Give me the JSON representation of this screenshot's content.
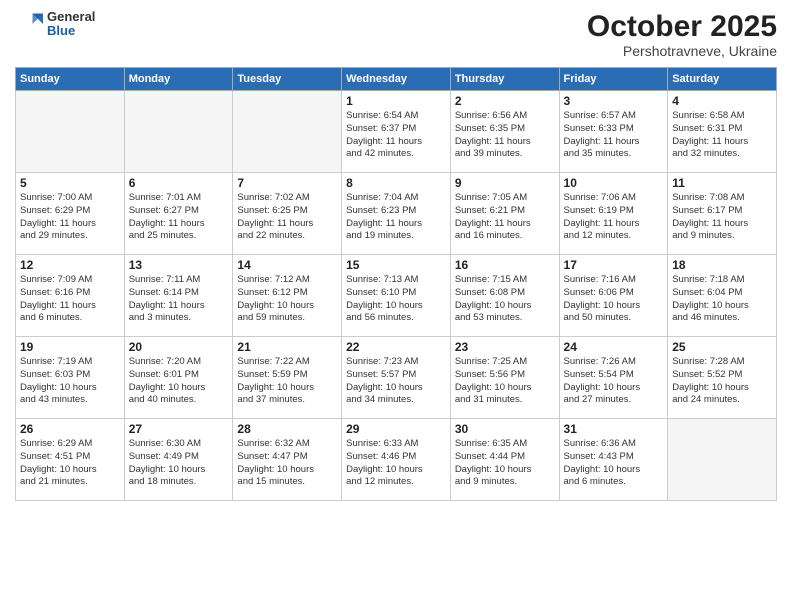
{
  "logo": {
    "general": "General",
    "blue": "Blue"
  },
  "title": {
    "month": "October 2025",
    "location": "Pershotravneve, Ukraine"
  },
  "weekdays": [
    "Sunday",
    "Monday",
    "Tuesday",
    "Wednesday",
    "Thursday",
    "Friday",
    "Saturday"
  ],
  "weeks": [
    [
      {
        "day": "",
        "info": ""
      },
      {
        "day": "",
        "info": ""
      },
      {
        "day": "",
        "info": ""
      },
      {
        "day": "1",
        "info": "Sunrise: 6:54 AM\nSunset: 6:37 PM\nDaylight: 11 hours\nand 42 minutes."
      },
      {
        "day": "2",
        "info": "Sunrise: 6:56 AM\nSunset: 6:35 PM\nDaylight: 11 hours\nand 39 minutes."
      },
      {
        "day": "3",
        "info": "Sunrise: 6:57 AM\nSunset: 6:33 PM\nDaylight: 11 hours\nand 35 minutes."
      },
      {
        "day": "4",
        "info": "Sunrise: 6:58 AM\nSunset: 6:31 PM\nDaylight: 11 hours\nand 32 minutes."
      }
    ],
    [
      {
        "day": "5",
        "info": "Sunrise: 7:00 AM\nSunset: 6:29 PM\nDaylight: 11 hours\nand 29 minutes."
      },
      {
        "day": "6",
        "info": "Sunrise: 7:01 AM\nSunset: 6:27 PM\nDaylight: 11 hours\nand 25 minutes."
      },
      {
        "day": "7",
        "info": "Sunrise: 7:02 AM\nSunset: 6:25 PM\nDaylight: 11 hours\nand 22 minutes."
      },
      {
        "day": "8",
        "info": "Sunrise: 7:04 AM\nSunset: 6:23 PM\nDaylight: 11 hours\nand 19 minutes."
      },
      {
        "day": "9",
        "info": "Sunrise: 7:05 AM\nSunset: 6:21 PM\nDaylight: 11 hours\nand 16 minutes."
      },
      {
        "day": "10",
        "info": "Sunrise: 7:06 AM\nSunset: 6:19 PM\nDaylight: 11 hours\nand 12 minutes."
      },
      {
        "day": "11",
        "info": "Sunrise: 7:08 AM\nSunset: 6:17 PM\nDaylight: 11 hours\nand 9 minutes."
      }
    ],
    [
      {
        "day": "12",
        "info": "Sunrise: 7:09 AM\nSunset: 6:16 PM\nDaylight: 11 hours\nand 6 minutes."
      },
      {
        "day": "13",
        "info": "Sunrise: 7:11 AM\nSunset: 6:14 PM\nDaylight: 11 hours\nand 3 minutes."
      },
      {
        "day": "14",
        "info": "Sunrise: 7:12 AM\nSunset: 6:12 PM\nDaylight: 10 hours\nand 59 minutes."
      },
      {
        "day": "15",
        "info": "Sunrise: 7:13 AM\nSunset: 6:10 PM\nDaylight: 10 hours\nand 56 minutes."
      },
      {
        "day": "16",
        "info": "Sunrise: 7:15 AM\nSunset: 6:08 PM\nDaylight: 10 hours\nand 53 minutes."
      },
      {
        "day": "17",
        "info": "Sunrise: 7:16 AM\nSunset: 6:06 PM\nDaylight: 10 hours\nand 50 minutes."
      },
      {
        "day": "18",
        "info": "Sunrise: 7:18 AM\nSunset: 6:04 PM\nDaylight: 10 hours\nand 46 minutes."
      }
    ],
    [
      {
        "day": "19",
        "info": "Sunrise: 7:19 AM\nSunset: 6:03 PM\nDaylight: 10 hours\nand 43 minutes."
      },
      {
        "day": "20",
        "info": "Sunrise: 7:20 AM\nSunset: 6:01 PM\nDaylight: 10 hours\nand 40 minutes."
      },
      {
        "day": "21",
        "info": "Sunrise: 7:22 AM\nSunset: 5:59 PM\nDaylight: 10 hours\nand 37 minutes."
      },
      {
        "day": "22",
        "info": "Sunrise: 7:23 AM\nSunset: 5:57 PM\nDaylight: 10 hours\nand 34 minutes."
      },
      {
        "day": "23",
        "info": "Sunrise: 7:25 AM\nSunset: 5:56 PM\nDaylight: 10 hours\nand 31 minutes."
      },
      {
        "day": "24",
        "info": "Sunrise: 7:26 AM\nSunset: 5:54 PM\nDaylight: 10 hours\nand 27 minutes."
      },
      {
        "day": "25",
        "info": "Sunrise: 7:28 AM\nSunset: 5:52 PM\nDaylight: 10 hours\nand 24 minutes."
      }
    ],
    [
      {
        "day": "26",
        "info": "Sunrise: 6:29 AM\nSunset: 4:51 PM\nDaylight: 10 hours\nand 21 minutes."
      },
      {
        "day": "27",
        "info": "Sunrise: 6:30 AM\nSunset: 4:49 PM\nDaylight: 10 hours\nand 18 minutes."
      },
      {
        "day": "28",
        "info": "Sunrise: 6:32 AM\nSunset: 4:47 PM\nDaylight: 10 hours\nand 15 minutes."
      },
      {
        "day": "29",
        "info": "Sunrise: 6:33 AM\nSunset: 4:46 PM\nDaylight: 10 hours\nand 12 minutes."
      },
      {
        "day": "30",
        "info": "Sunrise: 6:35 AM\nSunset: 4:44 PM\nDaylight: 10 hours\nand 9 minutes."
      },
      {
        "day": "31",
        "info": "Sunrise: 6:36 AM\nSunset: 4:43 PM\nDaylight: 10 hours\nand 6 minutes."
      },
      {
        "day": "",
        "info": ""
      }
    ]
  ]
}
